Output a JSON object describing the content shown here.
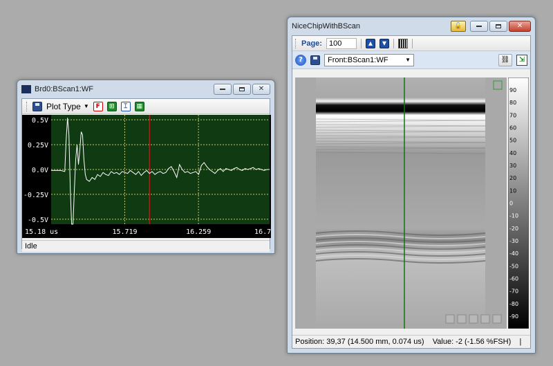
{
  "colors": {
    "plot_bg": "#0f3a12",
    "plot_grid": "#c9c96a",
    "signal": "#ffffff",
    "cursor_red": "#cc1b1b",
    "cursor_green": "#0b7a0b",
    "desktop": "#ababab"
  },
  "wf_window": {
    "title": "Brd0:BScan1:WF",
    "plot_type_label": "Plot Type",
    "status": "Idle",
    "icons": [
      "save-icon",
      "plot-type-dropdown-icon",
      "f-icon",
      "zoom-fit-icon",
      "cursor-icon",
      "grid-icon"
    ]
  },
  "bscan_window": {
    "title": "NiceChipWithBScan",
    "page_label": "Page:",
    "page_value": "100",
    "view_select": "Front:BScan1:WF",
    "status_position": "Position: 39,37 (14.500 mm, 0.074 us)",
    "status_value": "Value: -2 (-1.56 %FSH)",
    "status_sep": "|"
  },
  "chart_data": [
    {
      "type": "line",
      "title": "",
      "xlabel": "",
      "ylabel": "",
      "ylim": [
        -0.55,
        0.55
      ],
      "y_ticks": [
        "0.5V",
        "0.25V",
        "0.0V",
        "-0.25V",
        "-0.5V"
      ],
      "y_tick_values": [
        0.5,
        0.25,
        0.0,
        -0.25,
        -0.5
      ],
      "xlim": [
        15.18,
        16.78
      ],
      "x_ticks": [
        "15.18 us",
        "15.719",
        "16.259",
        "16.7"
      ],
      "x_tick_values": [
        15.18,
        15.719,
        16.259,
        16.76
      ],
      "grid": true,
      "cursor_x": 15.9,
      "series": [
        {
          "x": [
            15.18,
            15.25,
            15.28,
            15.29,
            15.3,
            15.31,
            15.32,
            15.33,
            15.34,
            15.35,
            15.36,
            15.37,
            15.38,
            15.39,
            15.4,
            15.41,
            15.42,
            15.43,
            15.44,
            15.46,
            15.48,
            15.5,
            15.52,
            15.54,
            15.56,
            15.58,
            15.6,
            15.62,
            15.64,
            15.66,
            15.68,
            15.7,
            15.72,
            15.74,
            15.76,
            15.78,
            15.8,
            15.82,
            15.84,
            15.86,
            15.88,
            15.9,
            15.92,
            15.94,
            15.96,
            15.98,
            16.0,
            16.02,
            16.04,
            16.06,
            16.08,
            16.1,
            16.12,
            16.14,
            16.16,
            16.18,
            16.2,
            16.22,
            16.24,
            16.26,
            16.28,
            16.3,
            16.32,
            16.34,
            16.36,
            16.38,
            16.4,
            16.42,
            16.44,
            16.46,
            16.48,
            16.5,
            16.52,
            16.54,
            16.56,
            16.58,
            16.6,
            16.62,
            16.64,
            16.66,
            16.68,
            16.7,
            16.72,
            16.74,
            16.76,
            16.78
          ],
          "y": [
            -0.01,
            -0.01,
            -0.02,
            0.3,
            0.52,
            0.35,
            -0.2,
            -0.6,
            -0.55,
            -0.2,
            0.1,
            0.25,
            0.05,
            0.2,
            0.38,
            0.35,
            0.1,
            -0.05,
            -0.1,
            -0.12,
            -0.08,
            -0.1,
            -0.05,
            -0.07,
            -0.03,
            -0.05,
            -0.06,
            -0.02,
            -0.04,
            -0.03,
            -0.05,
            -0.02,
            -0.03,
            -0.04,
            -0.01,
            -0.03,
            -0.05,
            -0.02,
            -0.06,
            -0.03,
            -0.01,
            -0.04,
            -0.02,
            -0.05,
            -0.03,
            -0.02,
            -0.04,
            -0.03,
            0.01,
            0.03,
            -0.02,
            -0.08,
            0.05,
            0.0,
            -0.03,
            -0.02,
            -0.04,
            -0.03,
            -0.02,
            -0.05,
            0.04,
            0.07,
            0.03,
            0.0,
            -0.02,
            -0.04,
            -0.01,
            0.01,
            -0.02,
            0.01,
            0.0,
            -0.01,
            0.01,
            0.02,
            0.0,
            -0.01,
            0.01,
            0.0,
            0.01,
            0.02,
            0.0,
            0.01,
            0.0,
            -0.01,
            0.0,
            0.0
          ]
        }
      ]
    },
    {
      "type": "heatmap",
      "title": "",
      "colorbar_ticks": [
        "90",
        "80",
        "70",
        "60",
        "50",
        "40",
        "30",
        "20",
        "10",
        "0",
        "-10",
        "-20",
        "-30",
        "-40",
        "-50",
        "-60",
        "-70",
        "-80",
        "-90"
      ],
      "colorbar_range": [
        -100,
        100
      ],
      "cursor_x_fraction": 0.5
    }
  ]
}
